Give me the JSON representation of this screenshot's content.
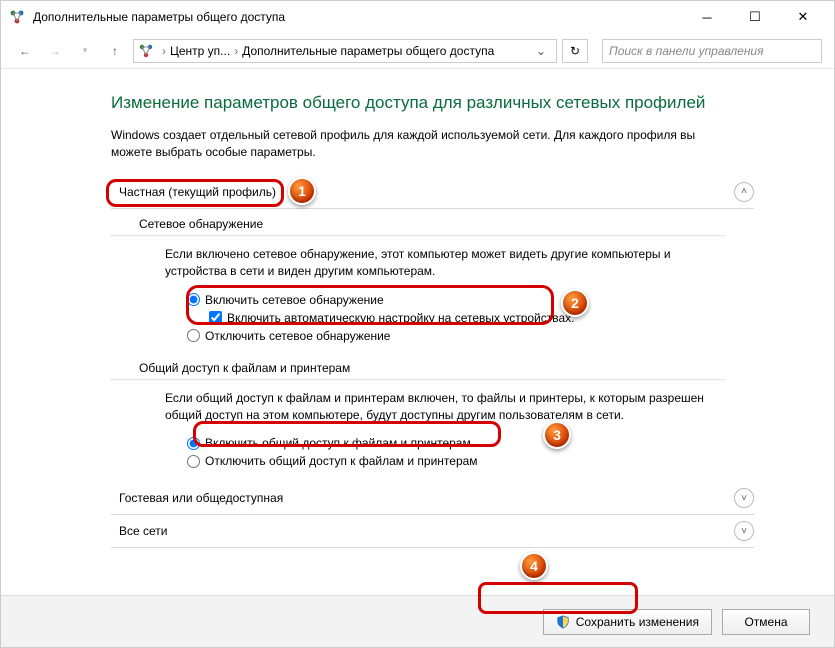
{
  "window": {
    "title": "Дополнительные параметры общего доступа"
  },
  "nav": {
    "crumb1": "Центр уп...",
    "crumb2": "Дополнительные параметры общего доступа",
    "search_placeholder": "Поиск в панели управления"
  },
  "page": {
    "heading": "Изменение параметров общего доступа для различных сетевых профилей",
    "lead": "Windows создает отдельный сетевой профиль для каждой используемой сети. Для каждого профиля вы можете выбрать особые параметры."
  },
  "profile_private": {
    "title": "Частная (текущий профиль)",
    "discovery": {
      "heading": "Сетевое обнаружение",
      "desc": "Если включено сетевое обнаружение, этот компьютер может видеть другие компьютеры и устройства в сети и виден другим компьютерам.",
      "on": "Включить сетевое обнаружение",
      "auto": "Включить автоматическую настройку на сетевых устройствах.",
      "off": "Отключить сетевое обнаружение"
    },
    "sharing": {
      "heading": "Общий доступ к файлам и принтерам",
      "desc": "Если общий доступ к файлам и принтерам включен, то файлы и принтеры, к которым разрешен общий доступ на этом компьютере, будут доступны другим пользователям в сети.",
      "on": "Включить общий доступ к файлам и принтерам",
      "off": "Отключить общий доступ к файлам и принтерам"
    }
  },
  "profile_guest": {
    "title": "Гостевая или общедоступная"
  },
  "profile_all": {
    "title": "Все сети"
  },
  "footer": {
    "save": "Сохранить изменения",
    "cancel": "Отмена"
  },
  "callouts": {
    "c1": "1",
    "c2": "2",
    "c3": "3",
    "c4": "4"
  }
}
